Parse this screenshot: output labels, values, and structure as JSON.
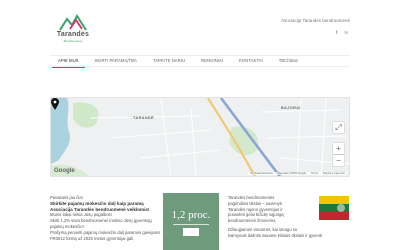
{
  "header": {
    "logo_title": "Tarandės",
    "logo_subtitle": "Bendruomenė",
    "tagline": "Asociacija Tarandės bendruomenė",
    "social": [
      {
        "icon": "facebook-icon",
        "glyph": "f"
      },
      {
        "icon": "email-icon",
        "glyph": "✉"
      }
    ]
  },
  "nav": {
    "items": [
      {
        "label": "APIE MUS",
        "active": true
      },
      {
        "label": "SKIRTI PARAMĄ/TBA",
        "active": false
      },
      {
        "label": "TAPKITE NARIU",
        "active": false
      },
      {
        "label": "RENGINIAI",
        "active": false
      },
      {
        "label": "KONTAKTAI",
        "active": false
      },
      {
        "label": "TBChitras",
        "active": false
      }
    ]
  },
  "map": {
    "labels": {
      "baj": "BAJORAI",
      "tar": "TARANDĖ"
    },
    "footer": [
      "Keyboard shortcuts",
      "Map data ©2025 Google",
      "Terms",
      "Report a map error"
    ],
    "google": "Google",
    "zoom_in": "+",
    "zoom_out": "−"
  },
  "content": {
    "greeting": "Pavasaris jau čia!",
    "headline": "Skirkite pajamų mokesčio dalį kaip paramą Asociacija Tarandės bendruomenė veiklomis!",
    "lines": [
      "Mums labai reikia Jūsų pagalbos!",
      "Skirti 1,2% savo bendruomenei metinio Jūsų gyventojų pajamų mokesčio!",
      "Prašymą pervesti pajamų mokesčio dalį paramos gavėjams FR0512 formą už 2025 metus gyventojai gali"
    ]
  },
  "card": {
    "value": "1,2 proc."
  },
  "about": {
    "lines": [
      "Tarandės bendruomenės",
      "pagrindinis tikslas – suvienyti",
      "Tarandės rajono gyventojus ir",
      "puoselėti gėlai bičiulę sąjungą",
      "bendruomenės žmonėms,",
      "Džiaugiamės visuomet, kai smagu su",
      "kaimynais dalintis savame kilniais tikslais ir gyventi"
    ]
  }
}
